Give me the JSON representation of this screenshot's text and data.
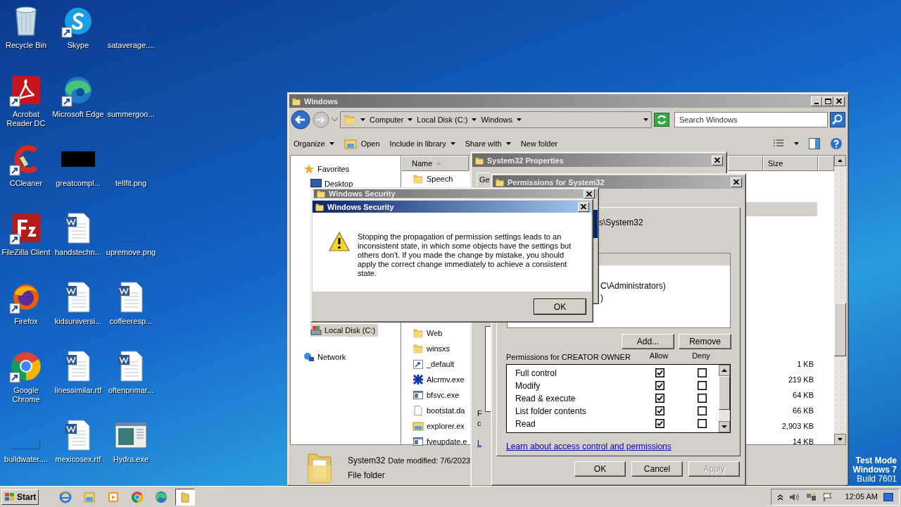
{
  "desktop_icons": [
    {
      "label": "Recycle Bin",
      "kind": "recycle",
      "shortcut": false
    },
    {
      "label": "Acrobat Reader DC",
      "kind": "acrobat",
      "shortcut": true
    },
    {
      "label": "CCleaner",
      "kind": "ccleaner",
      "shortcut": true
    },
    {
      "label": "FileZilla Client",
      "kind": "filezilla",
      "shortcut": true
    },
    {
      "label": "Firefox",
      "kind": "firefox",
      "shortcut": true
    },
    {
      "label": "Google Chrome",
      "kind": "chrome",
      "shortcut": true
    },
    {
      "label": "buildwater....",
      "kind": "blank",
      "shortcut": false
    },
    {
      "label": "Skype",
      "kind": "skype",
      "shortcut": true
    },
    {
      "label": "Microsoft Edge",
      "kind": "edge",
      "shortcut": true
    },
    {
      "label": "greatcompl...",
      "kind": "black",
      "shortcut": false
    },
    {
      "label": "handstechn...",
      "kind": "word",
      "shortcut": false
    },
    {
      "label": "kidsuniversi...",
      "kind": "word",
      "shortcut": false
    },
    {
      "label": "linessimilar.rtf",
      "kind": "word",
      "shortcut": false
    },
    {
      "label": "mexicosex.rtf",
      "kind": "word",
      "shortcut": false
    },
    {
      "label": "sataverage....",
      "kind": "blank",
      "shortcut": false
    },
    {
      "label": "summergoo...",
      "kind": "blank",
      "shortcut": false
    },
    {
      "label": "tellfit.png",
      "kind": "blank",
      "shortcut": false
    },
    {
      "label": "upremove.png",
      "kind": "blank",
      "shortcut": false
    },
    {
      "label": "coffeeresp...",
      "kind": "word",
      "shortcut": false
    },
    {
      "label": "oftenprimar...",
      "kind": "word",
      "shortcut": false
    },
    {
      "label": "Hydra.exe",
      "kind": "exe",
      "shortcut": false
    }
  ],
  "explorer": {
    "title": "Windows",
    "breadcrumb": [
      "Computer",
      "Local Disk (C:)",
      "Windows"
    ],
    "search": {
      "placeholder": "Search Windows"
    },
    "toolbar": [
      {
        "label": "Organize",
        "kind": "plain",
        "dropdown": true
      },
      {
        "label": "Open",
        "kind": "open",
        "dropdown": false
      },
      {
        "label": "Include in library",
        "kind": "plain",
        "dropdown": true
      },
      {
        "label": "Share with",
        "kind": "plain",
        "dropdown": true
      },
      {
        "label": "New folder",
        "kind": "plain",
        "dropdown": false
      }
    ],
    "nav": [
      {
        "label": "Favorites",
        "kind": "star",
        "selected": false
      },
      {
        "label": "Desktop",
        "kind": "desktop",
        "selected": false
      },
      {
        "label": "Local Disk (C:)",
        "kind": "disk",
        "selected": true
      },
      {
        "label": "Network",
        "kind": "network",
        "selected": false
      }
    ],
    "columns": [
      "Name",
      "Size"
    ],
    "files_top": [
      {
        "name": "Speech",
        "kind": "folder"
      }
    ],
    "files": [
      {
        "name": "Web",
        "kind": "folder"
      },
      {
        "name": "winsxs",
        "kind": "folder"
      },
      {
        "name": "_default",
        "kind": "shortcut",
        "size": "1 KB"
      },
      {
        "name": "Alcrmv.exe",
        "kind": "exe",
        "size": "219 KB"
      },
      {
        "name": "bfsvc.exe",
        "kind": "app",
        "size": "64 KB"
      },
      {
        "name": "bootstat.da",
        "kind": "file",
        "size": "66 KB"
      },
      {
        "name": "explorer.ex",
        "kind": "explorer",
        "size": "2,903 KB"
      },
      {
        "name": "fveupdate.e",
        "kind": "app",
        "size": "14 KB"
      }
    ],
    "details": {
      "name": "System32",
      "date": "Date modified: 7/6/2023",
      "type": "File folder"
    }
  },
  "properties": {
    "title": "System32 Properties",
    "tab": "Ge",
    "fragments": [
      "F",
      "c",
      "L"
    ]
  },
  "permissions": {
    "title": "Permissions for System32",
    "object": "s\\System32",
    "principals": [
      "C\\Administrators)",
      ")"
    ],
    "add": "Add...",
    "remove": "Remove",
    "perm_label": "Permissions for CREATOR OWNER",
    "allow": "Allow",
    "deny": "Deny",
    "rows": [
      {
        "name": "Full control",
        "allow": true,
        "deny": false
      },
      {
        "name": "Modify",
        "allow": true,
        "deny": false
      },
      {
        "name": "Read & execute",
        "allow": true,
        "deny": false
      },
      {
        "name": "List folder contents",
        "allow": true,
        "deny": false
      },
      {
        "name": "Read",
        "allow": true,
        "deny": false
      }
    ],
    "link": "Learn about access control and permissions",
    "buttons": [
      {
        "label": "OK",
        "disabled": false
      },
      {
        "label": "Cancel",
        "disabled": false
      },
      {
        "label": "Apply",
        "disabled": true
      }
    ]
  },
  "security_back": {
    "title": "Windows Security"
  },
  "security": {
    "title": "Windows Security",
    "message": "Stopping the propagation of permission settings leads to an inconsistent state, in which some objects have the settings but others don't. If you made the change by mistake, you should apply the correct change immediately to achieve a consistent state.",
    "ok": "OK"
  },
  "taskbar": {
    "start": "Start",
    "apps": [
      {
        "kind": "ie",
        "active": false
      },
      {
        "kind": "explorer",
        "active": false
      },
      {
        "kind": "media",
        "active": false
      },
      {
        "kind": "chrome",
        "active": false
      },
      {
        "kind": "edge",
        "active": false
      },
      {
        "kind": "folder",
        "active": true
      }
    ],
    "clock": "12:05 AM"
  },
  "desktop_status": [
    "Test Mode",
    "Windows 7",
    "Build 7601"
  ]
}
